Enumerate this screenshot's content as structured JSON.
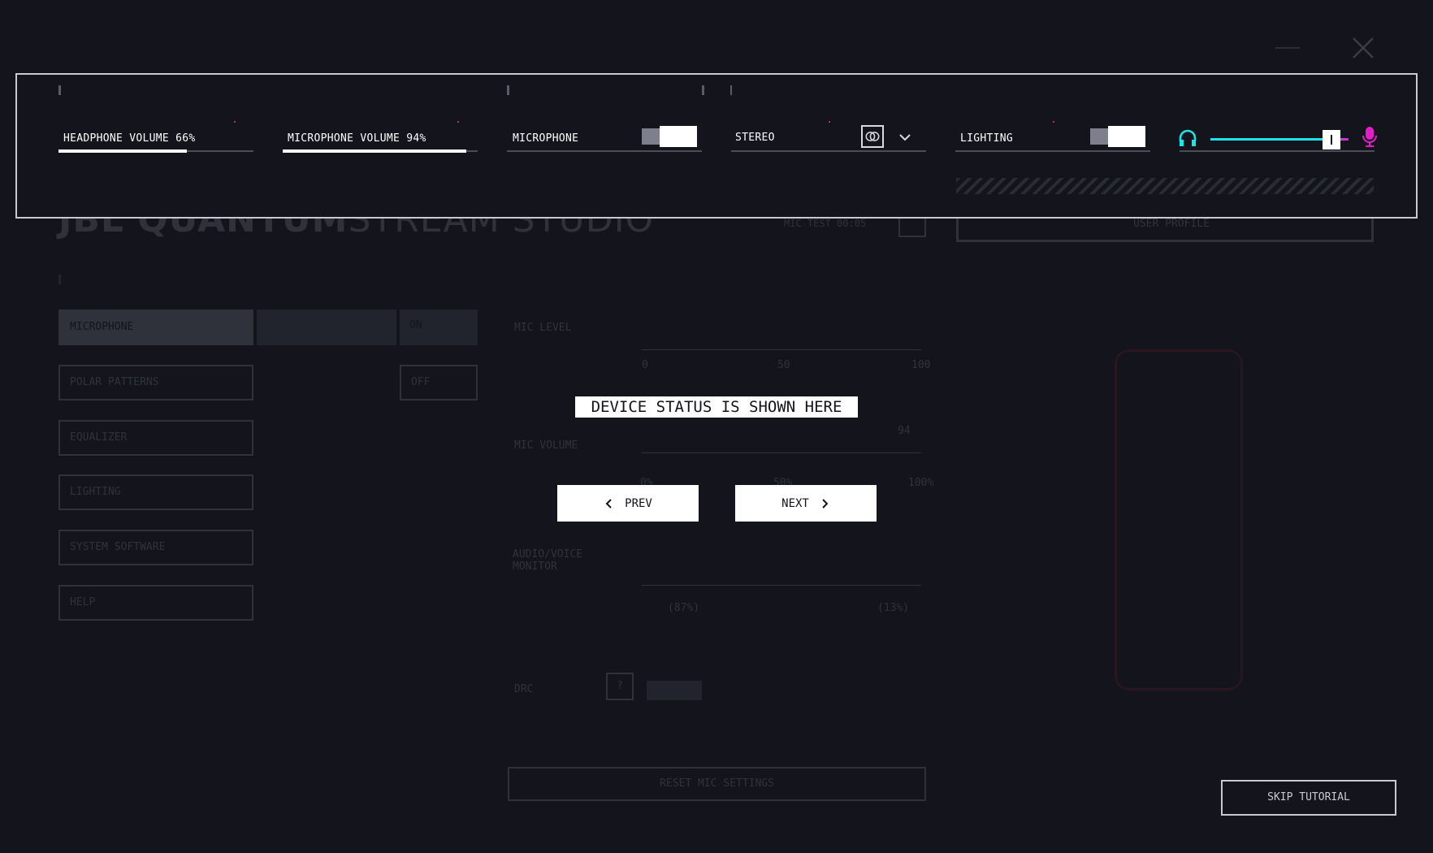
{
  "window": {
    "brand_bold": "JBL QUANTUM",
    "brand_light": "STREAM STUDIO"
  },
  "status_bar": {
    "headphone_volume_label": "HEADPHONE VOLUME 66%",
    "headphone_volume_percent": 66,
    "microphone_volume_label": "MICROPHONE VOLUME 94%",
    "microphone_volume_percent": 94,
    "microphone_label": "MICROPHONE",
    "microphone_toggle": "on",
    "stereo_label": "STEREO",
    "lighting_label": "LIGHTING",
    "lighting_toggle": "on",
    "monitor_mix_level": 0.87,
    "headphone_color": "#1ee3e8",
    "mic_color": "#e21ec9"
  },
  "background_app": {
    "mic_test_label": "MIC TEST 00:05",
    "profile_label": "USER PROFILE",
    "sidebar_items": [
      "MICROPHONE",
      "POLAR PATTERNS",
      "EQUALIZER",
      "LIGHTING",
      "SYSTEM SOFTWARE",
      "HELP"
    ],
    "on_label": "ON",
    "off_label": "OFF",
    "mic_level_label": "MIC LEVEL",
    "mic_volume_label": "MIC VOLUME",
    "mic_volume_value": "94",
    "audio_voice_monitor_label": "AUDIO/VOICE MONITOR",
    "monitor_left": "(87%)",
    "monitor_right": "(13%)",
    "drc_label": "DRC",
    "help_mark": "?",
    "scale": [
      "0",
      "50",
      "100"
    ],
    "scale_pct": [
      "0%",
      "50%",
      "100%"
    ],
    "reset_label": "RESET MIC SETTINGS"
  },
  "tutorial": {
    "tooltip": "DEVICE STATUS IS SHOWN HERE",
    "prev_label": "PREV",
    "next_label": "NEXT",
    "skip_label": "SKIP TUTORIAL"
  }
}
